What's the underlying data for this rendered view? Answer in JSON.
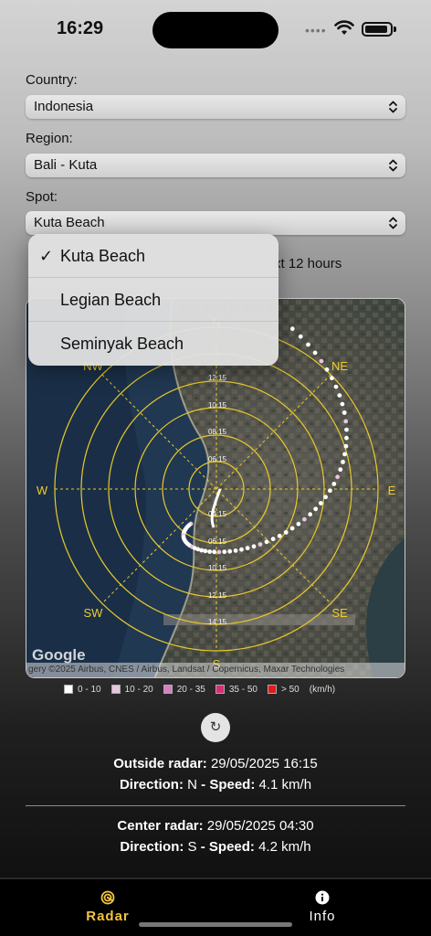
{
  "status": {
    "time": "16:29",
    "dots": "••••"
  },
  "form": {
    "country_label": "Country:",
    "country_value": "Indonesia",
    "region_label": "Region:",
    "region_value": "Bali - Kuta",
    "spot_label": "Spot:",
    "spot_value": "Kuta Beach"
  },
  "forecast_text": "xt 12 hours",
  "dropdown": {
    "check": "✓",
    "options": [
      "Kuta Beach",
      "Legian Beach",
      "Seminyak Beach"
    ],
    "selected": "Kuta Beach"
  },
  "radar": {
    "directions": {
      "n": "N",
      "ne": "NE",
      "e": "E",
      "se": "SE",
      "s": "S",
      "sw": "SW",
      "w": "W",
      "nw": "NW"
    },
    "ring_times_north": [
      "12:15",
      "10:15",
      "08:15",
      "06:15"
    ],
    "ring_times_south": [
      "04:15",
      "06:15",
      "10:15",
      "12:15",
      "14:15"
    ],
    "attribution": "gery ©2025 Airbus, CNES / Airbus, Landsat / Copernicus, Maxar Technologies",
    "logo": "Google",
    "ring_color": "#e9c92a",
    "track_color": "#ffffff"
  },
  "legend": {
    "items": [
      {
        "label": "0 - 10",
        "color": "#ffffff"
      },
      {
        "label": "10 - 20",
        "color": "#e6c6e0"
      },
      {
        "label": "20 - 35",
        "color": "#d77fc4"
      },
      {
        "label": "35 - 50",
        "color": "#d62e78"
      },
      {
        "label": "> 50",
        "color": "#e41a1a"
      }
    ],
    "unit": "(km/h)"
  },
  "refresh_icon": "↻",
  "outside": {
    "label": "Outside radar:",
    "datetime": "29/05/2025 16:15",
    "direction_label": "Direction:",
    "direction": "N",
    "speed_label": "- Speed:",
    "speed": "4.1 km/h"
  },
  "center": {
    "label": "Center radar:",
    "datetime": "29/05/2025 04:30",
    "direction_label": "Direction:",
    "direction": "S",
    "speed_label": "- Speed:",
    "speed": "4.2 km/h"
  },
  "tabs": [
    {
      "label": "Radar",
      "active": true,
      "icon": "radar-icon",
      "color": "#f4c542"
    },
    {
      "label": "Info",
      "active": false,
      "icon": "info-icon",
      "color": "#ffffff"
    }
  ]
}
